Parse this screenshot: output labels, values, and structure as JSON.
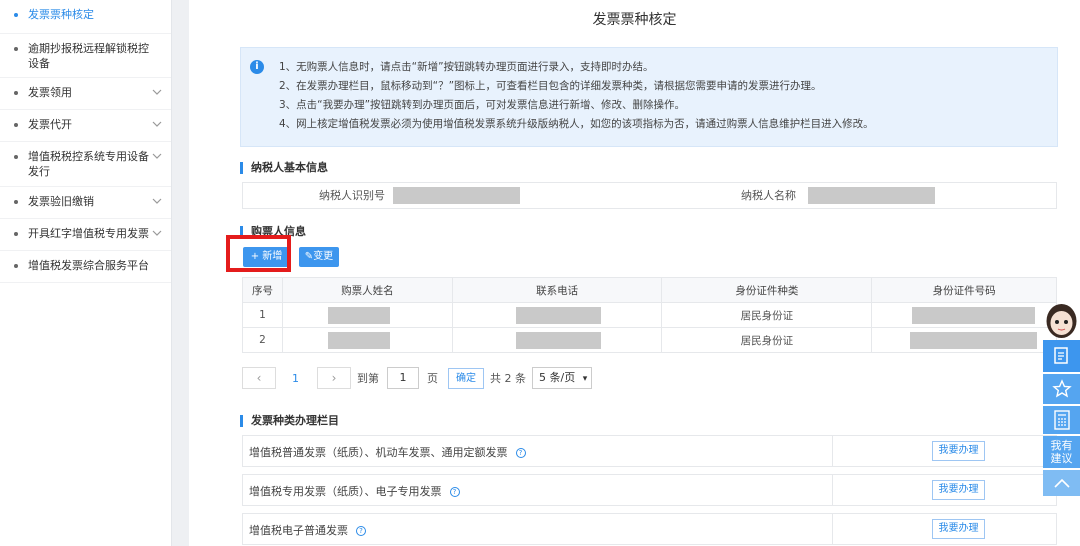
{
  "sidebar": {
    "items": [
      {
        "label": "发票票种核定",
        "active": true,
        "chevron": false
      },
      {
        "label": "逾期抄报税远程解锁税控设备",
        "active": false,
        "chevron": false
      },
      {
        "label": "发票领用",
        "active": false,
        "chevron": true
      },
      {
        "label": "发票代开",
        "active": false,
        "chevron": true
      },
      {
        "label": "增值税税控系统专用设备发行",
        "active": false,
        "chevron": true
      },
      {
        "label": "发票验旧缴销",
        "active": false,
        "chevron": true
      },
      {
        "label": "开具红字增值税专用发票",
        "active": false,
        "chevron": true
      },
      {
        "label": "增值税发票综合服务平台",
        "active": false,
        "chevron": false
      }
    ]
  },
  "page": {
    "title": "发票票种核定"
  },
  "notice": {
    "lines": [
      "1、无购票人信息时，请点击“新增”按钮跳转办理页面进行录入，支持即时办结。",
      "2、在发票办理栏目，鼠标移动到“？”图标上，可查看栏目包含的详细发票种类，请根据您需要申请的发票进行办理。",
      "3、点击“我要办理”按钮跳转到办理页面后，可对发票信息进行新增、修改、删除操作。",
      "4、网上核定增值税发票必须为使用增值税发票系统升级版纳税人，如您的该项指标为否，请通过购票人信息维护栏目进入修改。"
    ]
  },
  "taxpayer": {
    "section_title": "纳税人基本信息",
    "id_label": "纳税人识别号",
    "name_label": "纳税人名称"
  },
  "buyers": {
    "section_title": "购票人信息",
    "add_button": "+ 新增",
    "change_button": "变更",
    "columns": [
      "序号",
      "购票人姓名",
      "联系电话",
      "身份证件种类",
      "身份证件号码"
    ],
    "rows": [
      {
        "index": "1",
        "id_type": "居民身份证"
      },
      {
        "index": "2",
        "id_type": "居民身份证"
      }
    ]
  },
  "pager": {
    "prev": "‹",
    "current_page": "1",
    "next": "›",
    "goto_label": "到第",
    "goto_value": "1",
    "page_unit": "页",
    "confirm": "确定",
    "total": "共 2 条",
    "page_size": "5 条/页"
  },
  "invoice_types": {
    "section_title": "发票种类办理栏目",
    "rows": [
      {
        "label": "增值税普通发票（纸质）、机动车发票、通用定额发票",
        "action": "我要办理"
      },
      {
        "label": "增值税专用发票（纸质）、电子专用发票",
        "action": "我要办理"
      },
      {
        "label": "增值税电子普通发票",
        "action": "我要办理"
      }
    ]
  },
  "float_bar": {
    "suggest_label": "我有\n建议"
  },
  "colors": {
    "accent": "#2b8be8",
    "button": "#3d96ee",
    "highlight_box": "#e41c1c",
    "notice_bg": "#e8f2fd"
  }
}
